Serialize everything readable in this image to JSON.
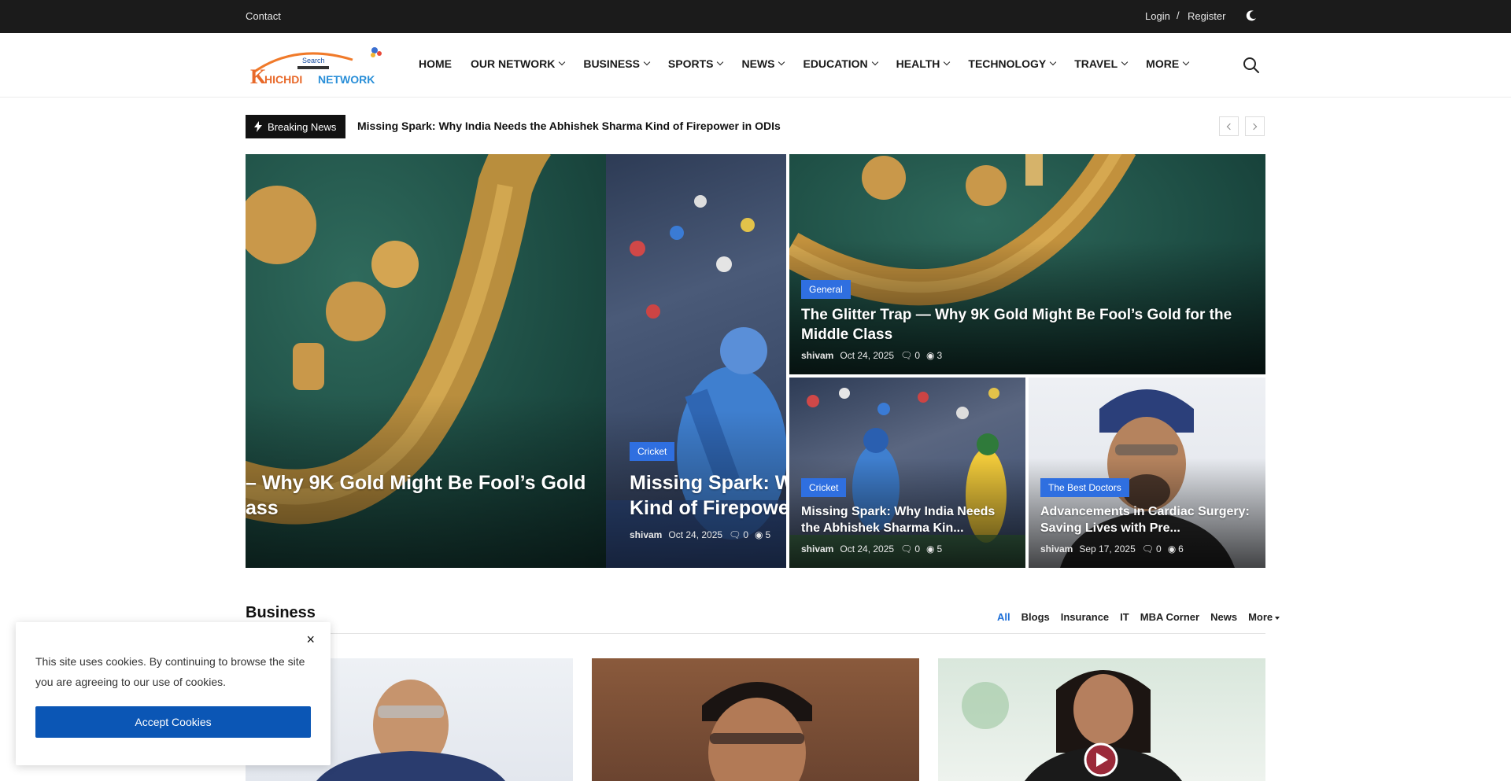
{
  "topbar": {
    "contact": "Contact",
    "login": "Login",
    "separator": "/",
    "register": "Register"
  },
  "brand": {
    "logo_small_text": "Search",
    "logo_name": "KHICHDI NETWORK"
  },
  "nav": [
    {
      "label": "HOME",
      "has_dropdown": false
    },
    {
      "label": "OUR NETWORK",
      "has_dropdown": true
    },
    {
      "label": "BUSINESS",
      "has_dropdown": true
    },
    {
      "label": "SPORTS",
      "has_dropdown": true
    },
    {
      "label": "NEWS",
      "has_dropdown": true
    },
    {
      "label": "EDUCATION",
      "has_dropdown": true
    },
    {
      "label": "HEALTH",
      "has_dropdown": true
    },
    {
      "label": "TECHNOLOGY",
      "has_dropdown": true
    },
    {
      "label": "TRAVEL",
      "has_dropdown": true
    },
    {
      "label": "MORE",
      "has_dropdown": true
    }
  ],
  "breaking": {
    "label": "Breaking News",
    "headline": "Missing Spark: Why India Needs the Abhishek Sharma Kind of Firepower in ODIs"
  },
  "slider": {
    "slide1": {
      "title_line1": "– Why 9K Gold Might Be Fool’s Gold",
      "title_line2": "ass"
    },
    "slide2": {
      "category": "Cricket",
      "title_line1": "Missing Spark: W",
      "title_line2": "Kind of Firepower",
      "author": "shivam",
      "date": "Oct 24, 2025",
      "comments": "0",
      "views": "5"
    }
  },
  "featured": {
    "main": {
      "category": "General",
      "title": "The Glitter Trap — Why 9K Gold Might Be Fool’s Gold for the Middle Class",
      "author": "shivam",
      "date": "Oct 24, 2025",
      "comments": "0",
      "views": "3"
    },
    "left": {
      "category": "Cricket",
      "title": "Missing Spark: Why India Needs the Abhishek Sharma Kin...",
      "author": "shivam",
      "date": "Oct 24, 2025",
      "comments": "0",
      "views": "5"
    },
    "right": {
      "category": "The Best Doctors",
      "title": "Advancements in Cardiac Surgery: Saving Lives with Pre...",
      "author": "shivam",
      "date": "Sep 17, 2025",
      "comments": "0",
      "views": "6"
    }
  },
  "business": {
    "title": "Business",
    "tabs": [
      "All",
      "Blogs",
      "Insurance",
      "IT",
      "MBA Corner",
      "News"
    ],
    "more": "More"
  },
  "cookie": {
    "close": "×",
    "text": "This site uses cookies. By continuing to browse the site you are agreeing to our use of cookies.",
    "accept": "Accept Cookies"
  },
  "colors": {
    "accent": "#2f6fe0",
    "topbar": "#1b1b1b",
    "accept_button": "#0b56b5",
    "active_tab": "#1d6fd8"
  }
}
